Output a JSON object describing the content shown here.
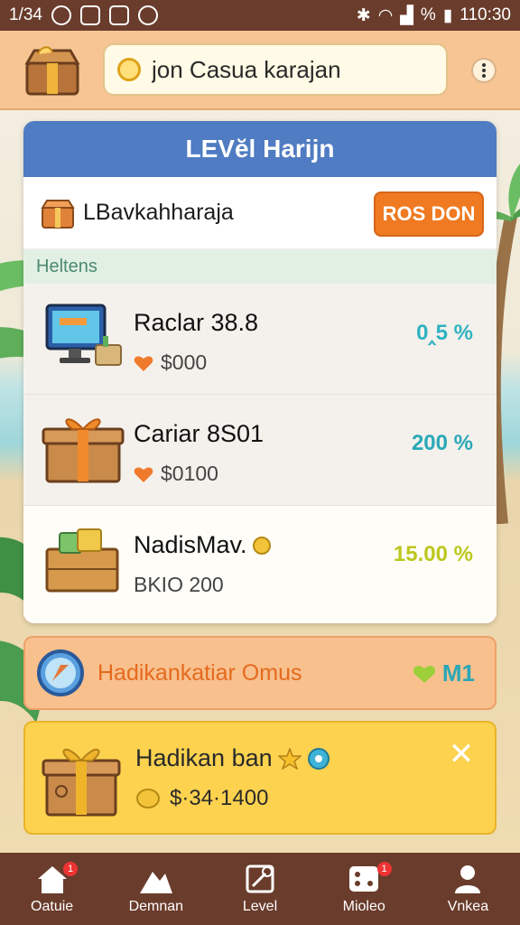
{
  "status_bar": {
    "time_left": "1/34",
    "time_right": "110:30",
    "signal_text": "%"
  },
  "app_bar": {
    "search_value": "jon Casua karajan"
  },
  "panel": {
    "title": "LEVĕl Harijn",
    "promo_label": "LBavkahharaja",
    "promo_button": "ROS DON",
    "section_label": "Heltens",
    "items": [
      {
        "name": "Raclar 38.8",
        "price": "$000",
        "percent": "0‸5 %"
      },
      {
        "name": "Cariar 8S01",
        "price": "$0100",
        "percent": "200 %"
      },
      {
        "name": "NadisMav.",
        "price": "BKIO 200",
        "percent": "15.00 %"
      }
    ]
  },
  "banner": {
    "label": "Hadikankatiar Omus",
    "badge": "M1"
  },
  "yellow_card": {
    "title": "Hadikan ban",
    "price": "$·34·1400",
    "close": "✕"
  },
  "bottom_nav": [
    {
      "label": "Oatuie",
      "badge": "1"
    },
    {
      "label": "Demnan",
      "badge": ""
    },
    {
      "label": "Level",
      "badge": ""
    },
    {
      "label": "Mioleo",
      "badge": "1"
    },
    {
      "label": "Vnkea",
      "badge": ""
    }
  ],
  "colors": {
    "status_bg": "#6a3c2c",
    "app_bar_bg": "#f6c593",
    "panel_header": "#4f7cc2",
    "promo_button": "#ef7a21",
    "banner_bg": "#f8c08d",
    "yellow_card": "#fcd24f"
  }
}
